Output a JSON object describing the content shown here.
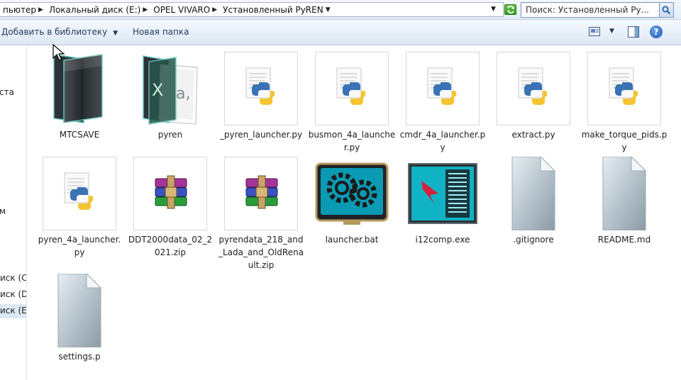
{
  "address": {
    "crumbs": [
      "пьютер",
      "Локальный диск (E:)",
      "OPEL VIVARO",
      "Установленный PyREN"
    ]
  },
  "search": {
    "placeholder": "Поиск: Установленный Ру..."
  },
  "toolbar": {
    "add_to_library": "Добавить в библиотеку",
    "new_folder": "Новая папка"
  },
  "nav": {
    "items": [
      {
        "label": "ста"
      },
      {
        "label": "м"
      },
      {
        "label": "иск (C:)"
      },
      {
        "label": "иск (D:"
      },
      {
        "label": "иск (E:)"
      }
    ]
  },
  "files": [
    {
      "name": "MTCSAVE",
      "type": "folder"
    },
    {
      "name": "pyren",
      "type": "folder-doc"
    },
    {
      "name": "_pyren_launcher.py",
      "type": "python"
    },
    {
      "name": "busmon_4a_launcher.py",
      "type": "python"
    },
    {
      "name": "cmdr_4a_launcher.py",
      "type": "python"
    },
    {
      "name": "extract.py",
      "type": "python"
    },
    {
      "name": "make_torque_pids.py",
      "type": "python"
    },
    {
      "name": "pyren_4a_launcher.py",
      "type": "python"
    },
    {
      "name": "DDT2000data_02_2021.zip",
      "type": "archive"
    },
    {
      "name": "pyrendata_218_and_Lada_and_OldRenault.zip",
      "type": "archive"
    },
    {
      "name": "launcher.bat",
      "type": "batch"
    },
    {
      "name": "i12comp.exe",
      "type": "exe"
    },
    {
      "name": ".gitignore",
      "type": "generic"
    },
    {
      "name": "README.md",
      "type": "generic"
    },
    {
      "name": "settings.p",
      "type": "generic"
    }
  ],
  "colors": {
    "accent": "#1e395b",
    "selection": "#dde8f5"
  }
}
